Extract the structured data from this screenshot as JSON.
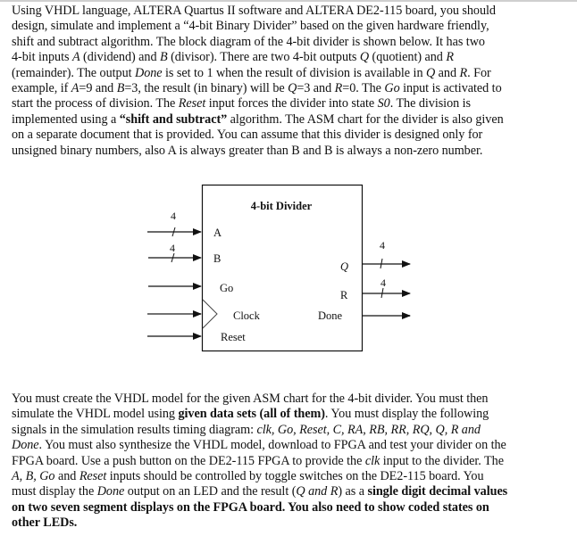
{
  "intro_paragraph": {
    "lines": [
      [
        {
          "t": "Using VHDL language, ALTERA Quartus II software and ALTERA DE2-115 board, you should"
        }
      ],
      [
        {
          "t": "design, simulate and implement a “4-bit Binary Divider” based on the given hardware friendly,"
        }
      ],
      [
        {
          "t": "shift and subtract algorithm. The block diagram of the 4-bit divider is shown below. It has two"
        }
      ],
      [
        {
          "t": "4-bit inputs "
        },
        {
          "t": "A",
          "s": "i"
        },
        {
          "t": " (dividend) and "
        },
        {
          "t": "B",
          "s": "i"
        },
        {
          "t": " (divisor). There are two 4-bit outputs "
        },
        {
          "t": "Q",
          "s": "i"
        },
        {
          "t": " (quotient) and "
        },
        {
          "t": "R",
          "s": "i"
        }
      ],
      [
        {
          "t": "(remainder). The output "
        },
        {
          "t": "Done",
          "s": "i"
        },
        {
          "t": " is set to 1 when the result of division is available in "
        },
        {
          "t": "Q",
          "s": "i"
        },
        {
          "t": " and "
        },
        {
          "t": "R",
          "s": "i"
        },
        {
          "t": ".  For"
        }
      ],
      [
        {
          "t": "example, if "
        },
        {
          "t": "A",
          "s": "i"
        },
        {
          "t": "=9 and "
        },
        {
          "t": "B",
          "s": "i"
        },
        {
          "t": "=3, the result (in binary) will be "
        },
        {
          "t": "Q",
          "s": "i"
        },
        {
          "t": "=3 and "
        },
        {
          "t": "R",
          "s": "i"
        },
        {
          "t": "=0. The "
        },
        {
          "t": "Go",
          "s": "i"
        },
        {
          "t": " input is activated to"
        }
      ],
      [
        {
          "t": "start the process of division. The "
        },
        {
          "t": "Reset",
          "s": "i"
        },
        {
          "t": " input forces the divider into state "
        },
        {
          "t": "S0",
          "s": "i"
        },
        {
          "t": ". The division is"
        }
      ],
      [
        {
          "t": "implemented using a "
        },
        {
          "t": "“shift and subtract”",
          "s": "b"
        },
        {
          "t": " algorithm. The ASM chart for the divider is also given"
        }
      ],
      [
        {
          "t": "on a separate document that is provided. You can assume that this divider is designed only for"
        }
      ],
      [
        {
          "t": "unsigned binary numbers, also A is always greater than B and B is always a non-zero number."
        }
      ]
    ]
  },
  "block_diagram": {
    "title": "4-bit Divider",
    "inputs": [
      {
        "label": "A",
        "italic": false,
        "bus_width": "4"
      },
      {
        "label": "B",
        "italic": false,
        "bus_width": "4"
      },
      {
        "label": "Go",
        "italic": false,
        "bus_width": null
      },
      {
        "label": "Clock",
        "italic": false,
        "bus_width": null,
        "clock_triangle": true
      },
      {
        "label": "Reset",
        "italic": false,
        "bus_width": null
      }
    ],
    "outputs": [
      {
        "label": "Q",
        "italic": true,
        "bus_width": "4"
      },
      {
        "label": "R",
        "italic": false,
        "bus_width": "4"
      },
      {
        "label": "Done",
        "italic": false,
        "bus_width": null
      }
    ]
  },
  "task_paragraph": {
    "lines": [
      [
        {
          "t": "You must create the VHDL model for the given ASM chart for the 4-bit divider. You must then"
        }
      ],
      [
        {
          "t": "simulate the VHDL model using "
        },
        {
          "t": "given data sets (all of them)",
          "s": "b"
        },
        {
          "t": ". You must display the following"
        }
      ],
      [
        {
          "t": "signals in the simulation results timing diagram: "
        },
        {
          "t": "clk, Go, Reset, C, RA, RB, RR, RQ, Q, R and",
          "s": "i"
        }
      ],
      [
        {
          "t": "Done",
          "s": "i"
        },
        {
          "t": ". You must also synthesize the VHDL model, download to FPGA and test your divider on the"
        }
      ],
      [
        {
          "t": "FPGA board. Use a push button on the DE2-115 FPGA to provide the "
        },
        {
          "t": "clk",
          "s": "i"
        },
        {
          "t": " input to the divider. The"
        }
      ],
      [
        {
          "t": "A, B, Go",
          "s": "i"
        },
        {
          "t": " and "
        },
        {
          "t": "Reset",
          "s": "i"
        },
        {
          "t": " inputs should be controlled by toggle switches on the DE2-115 board. You"
        }
      ],
      [
        {
          "t": "must display the "
        },
        {
          "t": "Done",
          "s": "i"
        },
        {
          "t": " output on an LED and the result ("
        },
        {
          "t": "Q and R",
          "s": "i"
        },
        {
          "t": ") as a "
        },
        {
          "t": "single digit decimal values",
          "s": "b"
        }
      ],
      [
        {
          "t": "on two seven segment displays on the FPGA board. You also need to show coded states on",
          "s": "b"
        }
      ],
      [
        {
          "t": "other LEDs.",
          "s": "b"
        }
      ]
    ]
  }
}
